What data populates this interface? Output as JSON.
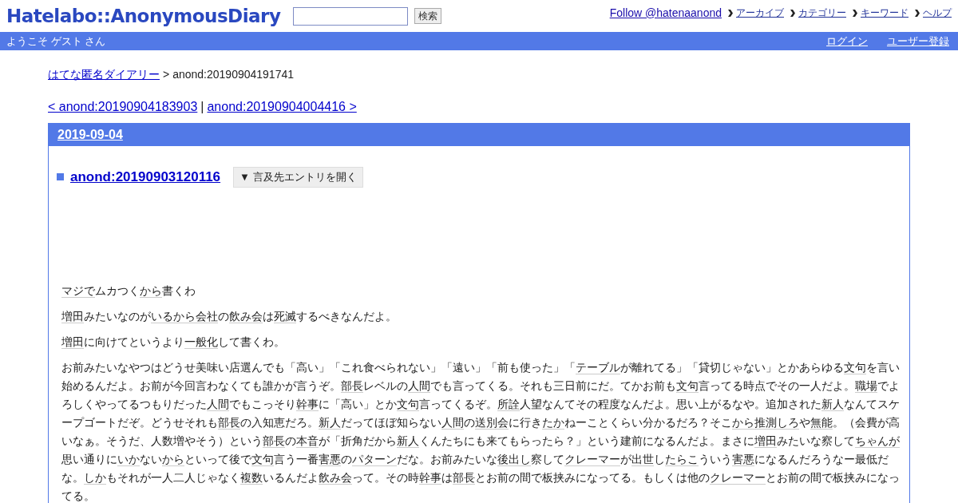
{
  "header": {
    "logo": "Hatelabo::AnonymousDiary",
    "search": {
      "button": "検索"
    },
    "links": [
      {
        "text": "Follow @hatenaanond",
        "kind": "follow"
      },
      {
        "text": "アーカイブ",
        "kind": "menu"
      },
      {
        "text": "カテゴリー",
        "kind": "menu"
      },
      {
        "text": "キーワード",
        "kind": "menu"
      },
      {
        "text": "ヘルプ",
        "kind": "menu"
      }
    ]
  },
  "userbar": {
    "welcome": "ようこそ ゲスト さん",
    "links": [
      "ログイン",
      "ユーザー登録"
    ]
  },
  "breadcrumb": {
    "home": "はてな匿名ダイアリー",
    "separator": ">",
    "current": "anond:20190904191741"
  },
  "pager": {
    "prev": "< anond:20190904183903",
    "separator": "|",
    "next": "anond:20190904004416 >"
  },
  "day": {
    "date": "2019-09-04",
    "entry": {
      "title": "anond:20190903120116",
      "toggle": "▼ 言及先エントリを開く",
      "paragraphs": [
        [
          {
            "text": "マジで",
            "keyword": true
          },
          {
            "text": "ムカつく",
            "keyword": false
          },
          {
            "text": "から",
            "keyword": true
          },
          {
            "text": "書くわ",
            "keyword": false
          }
        ],
        [
          {
            "text": "増田",
            "keyword": true
          },
          {
            "text": "みたいなのが",
            "keyword": false
          },
          {
            "text": "いるから",
            "keyword": true
          },
          {
            "text": "会社",
            "keyword": true
          },
          {
            "text": "の",
            "keyword": false
          },
          {
            "text": "飲み会",
            "keyword": true
          },
          {
            "text": "は",
            "keyword": false
          },
          {
            "text": "死滅",
            "keyword": true
          },
          {
            "text": "するべきなんだよ。",
            "keyword": false
          }
        ],
        [
          {
            "text": "増田",
            "keyword": true
          },
          {
            "text": "に向けてというより",
            "keyword": false
          },
          {
            "text": "一般化",
            "keyword": true
          },
          {
            "text": "して書くわ。",
            "keyword": false
          }
        ],
        [
          {
            "text": "お前みたいなやつはどうせ美味い店選んでも「高い」「これ食べられない」「遠い」「前も使った」「",
            "keyword": false
          },
          {
            "text": "テーブル",
            "keyword": true
          },
          {
            "text": "が離れてる」「貸切じゃない」とかあらゆる",
            "keyword": false
          },
          {
            "text": "文句",
            "keyword": true
          },
          {
            "text": "を言い始めるんだよ。お前が今回言わなくても誰かが言うぞ。",
            "keyword": false
          },
          {
            "text": "部長",
            "keyword": true
          },
          {
            "text": "レベルの",
            "keyword": false
          },
          {
            "text": "人間",
            "keyword": true
          },
          {
            "text": "でも言ってくる。それも三日前にだ。てかお前も",
            "keyword": false
          },
          {
            "text": "文句",
            "keyword": true
          },
          {
            "text": "言ってる時点でその一人だよ。",
            "keyword": false
          },
          {
            "text": "職場",
            "keyword": true
          },
          {
            "text": "でよろしくやってるつもりだった",
            "keyword": false
          },
          {
            "text": "人間",
            "keyword": true
          },
          {
            "text": "でもこっそり",
            "keyword": false
          },
          {
            "text": "幹事",
            "keyword": true
          },
          {
            "text": "に「高い」とか",
            "keyword": false
          },
          {
            "text": "文句",
            "keyword": true
          },
          {
            "text": "言ってくるぞ。",
            "keyword": false
          },
          {
            "text": "所詮",
            "keyword": true
          },
          {
            "text": "人望なんてその程度なんだよ。思い上がるなや。追加された",
            "keyword": false
          },
          {
            "text": "新人",
            "keyword": true
          },
          {
            "text": "なんてスケープゴートだぞ。どうせそれも",
            "keyword": false
          },
          {
            "text": "部長",
            "keyword": true
          },
          {
            "text": "の入知恵だろ。",
            "keyword": false
          },
          {
            "text": "新人",
            "keyword": true
          },
          {
            "text": "だってほぼ知らない",
            "keyword": false
          },
          {
            "text": "人間",
            "keyword": true
          },
          {
            "text": "の",
            "keyword": false
          },
          {
            "text": "送別会",
            "keyword": true
          },
          {
            "text": "に行き",
            "keyword": false
          },
          {
            "text": "たか",
            "keyword": true
          },
          {
            "text": "ねーことくらい分かるだろ？そこ",
            "keyword": false
          },
          {
            "text": "から",
            "keyword": true
          },
          {
            "text": "推測",
            "keyword": true
          },
          {
            "text": "しろ",
            "keyword": true
          },
          {
            "text": "や",
            "keyword": false
          },
          {
            "text": "無能",
            "keyword": true
          },
          {
            "text": "。（会費が高いなぁ。そうだ、人数増やそう）という",
            "keyword": false
          },
          {
            "text": "部長",
            "keyword": true
          },
          {
            "text": "の",
            "keyword": false
          },
          {
            "text": "本音",
            "keyword": true
          },
          {
            "text": "が「折角だから",
            "keyword": false
          },
          {
            "text": "新人",
            "keyword": true
          },
          {
            "text": "くんたちにも来てもらったら？」という建前になるんだよ。まさに",
            "keyword": false
          },
          {
            "text": "増田",
            "keyword": true
          },
          {
            "text": "みたいな察して",
            "keyword": false
          },
          {
            "text": "ちゃんが",
            "keyword": true
          },
          {
            "text": "思い通りに",
            "keyword": false
          },
          {
            "text": "いか",
            "keyword": true
          },
          {
            "text": "ない",
            "keyword": false
          },
          {
            "text": "から",
            "keyword": true
          },
          {
            "text": "といって後で",
            "keyword": false
          },
          {
            "text": "文句",
            "keyword": true
          },
          {
            "text": "言う一番",
            "keyword": false
          },
          {
            "text": "害悪",
            "keyword": true
          },
          {
            "text": "の",
            "keyword": false
          },
          {
            "text": "パターン",
            "keyword": true
          },
          {
            "text": "だな。お前みたいな",
            "keyword": false
          },
          {
            "text": "後出し",
            "keyword": true
          },
          {
            "text": "察して",
            "keyword": false
          },
          {
            "text": "クレーマー",
            "keyword": true
          },
          {
            "text": "が",
            "keyword": false
          },
          {
            "text": "出世",
            "keyword": true
          },
          {
            "text": "し",
            "keyword": false
          },
          {
            "text": "たらこ",
            "keyword": true
          },
          {
            "text": "ういう",
            "keyword": false
          },
          {
            "text": "害悪",
            "keyword": true
          },
          {
            "text": "になるんだろうなー最低だな。",
            "keyword": false
          },
          {
            "text": "しか",
            "keyword": true
          },
          {
            "text": "もそれが一人二人じゃなく",
            "keyword": false
          },
          {
            "text": "複数",
            "keyword": true
          },
          {
            "text": "いるんだよ",
            "keyword": false
          },
          {
            "text": "飲み会",
            "keyword": true
          },
          {
            "text": "って。その時",
            "keyword": false
          },
          {
            "text": "幹事",
            "keyword": true
          },
          {
            "text": "は",
            "keyword": false
          },
          {
            "text": "部長",
            "keyword": true
          },
          {
            "text": "とお前の間で板挟みになってる。もしくは他の",
            "keyword": false
          },
          {
            "text": "クレーマー",
            "keyword": true
          },
          {
            "text": "とお前の間で板挟みになってる。",
            "keyword": false
          }
        ]
      ]
    }
  }
}
